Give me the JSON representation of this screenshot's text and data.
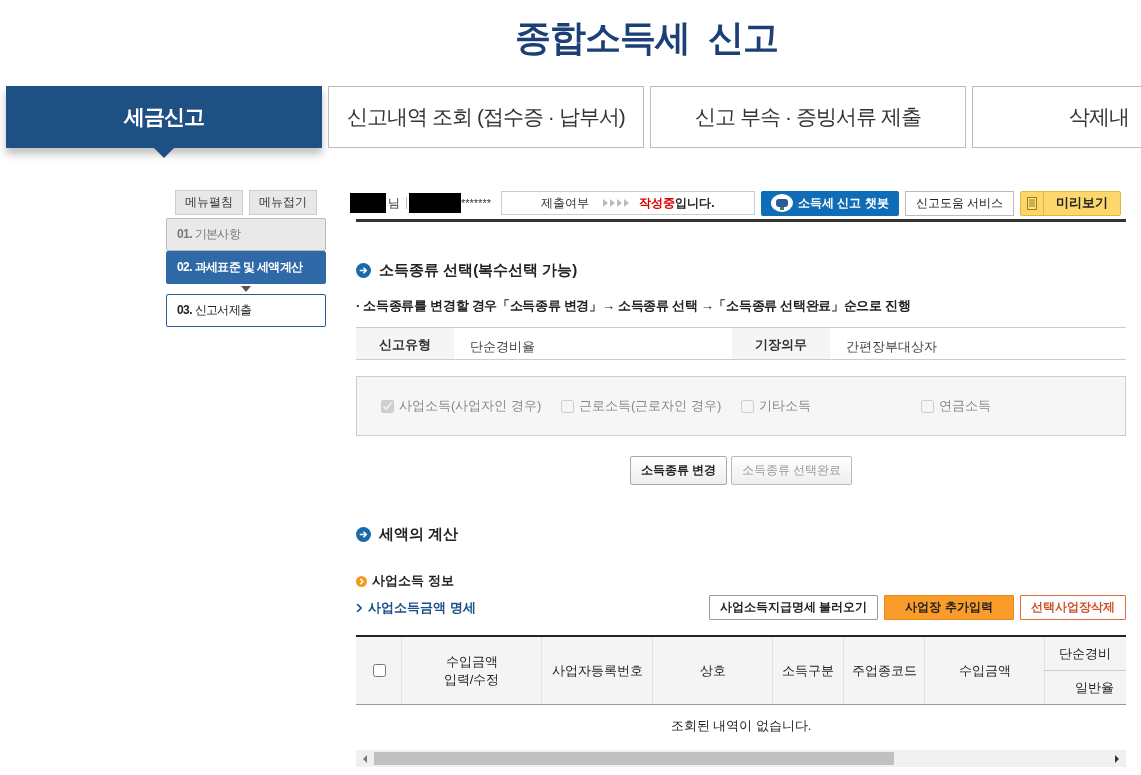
{
  "page_title": "종합소득세  신고",
  "tabs": [
    {
      "label": "세금신고",
      "selected": true
    },
    {
      "label": "신고내역 조회 (접수증 · 납부서)",
      "selected": false
    },
    {
      "label": "신고 부속 · 증빙서류 제출",
      "selected": false
    },
    {
      "label": "삭제내",
      "selected": false
    }
  ],
  "sidebar": {
    "buttons": [
      "메뉴펼침",
      "메뉴접기"
    ],
    "steps": [
      {
        "number": "01.",
        "label": "기본사항",
        "completed": true,
        "selected": false
      },
      {
        "number": "02.",
        "label": "과세표준 및 세액계산",
        "completed": false,
        "selected": true
      },
      {
        "number": "03.",
        "label": "신고서제출",
        "completed": false,
        "selected": false
      }
    ]
  },
  "toolbar": {
    "user_suffix": "님",
    "masked_id": "*******",
    "status_label": "제출여부",
    "status_value": "작성중",
    "status_suffix": "입니다.",
    "chatbot_button": "소득세 신고 챗봇",
    "help_button": "신고도움 서비스",
    "preview_button": "미리보기"
  },
  "income_type_section": {
    "title": "소득종류 선택(복수선택 가능)",
    "note": "· 소득종류를 변경할 경우「소득종류 변경」→ 소득종류 선택 →「소득종류 선택완료」순으로 진행",
    "info": [
      {
        "label": "신고유형",
        "value": "단순경비율"
      },
      {
        "label": "기장의무",
        "value": "간편장부대상자"
      }
    ],
    "options": [
      {
        "label": "사업소득(사업자인 경우)",
        "checked": true,
        "disabled": true
      },
      {
        "label": "근로소득(근로자인 경우)",
        "checked": false,
        "disabled": true
      },
      {
        "label": "기타소득",
        "checked": false,
        "disabled": true
      },
      {
        "label": "연금소득",
        "checked": false,
        "disabled": true
      }
    ],
    "buttons": [
      {
        "label": "소득종류 변경",
        "disabled": false
      },
      {
        "label": "소득종류 선택완료",
        "disabled": true
      }
    ]
  },
  "tax_section": {
    "title": "세액의 계산",
    "subtitle": "사업소득 정보",
    "link": "사업소득금액 명세",
    "buttons": [
      {
        "label": "사업소득지급명세 불러오기",
        "kind": "plain"
      },
      {
        "label": "사업장 추가입력",
        "kind": "primary"
      },
      {
        "label": "선택사업장삭제",
        "kind": "danger"
      }
    ],
    "table": {
      "select_all_checked": false,
      "columns": [
        "수입금액\n입력/수정",
        "사업자등록번호",
        "상호",
        "소득구분",
        "주업종코드",
        "수입금액"
      ],
      "group_column": "단순경비",
      "sub_columns": [
        "일반율"
      ],
      "empty_message": "조회된 내역이 없습니다."
    }
  }
}
